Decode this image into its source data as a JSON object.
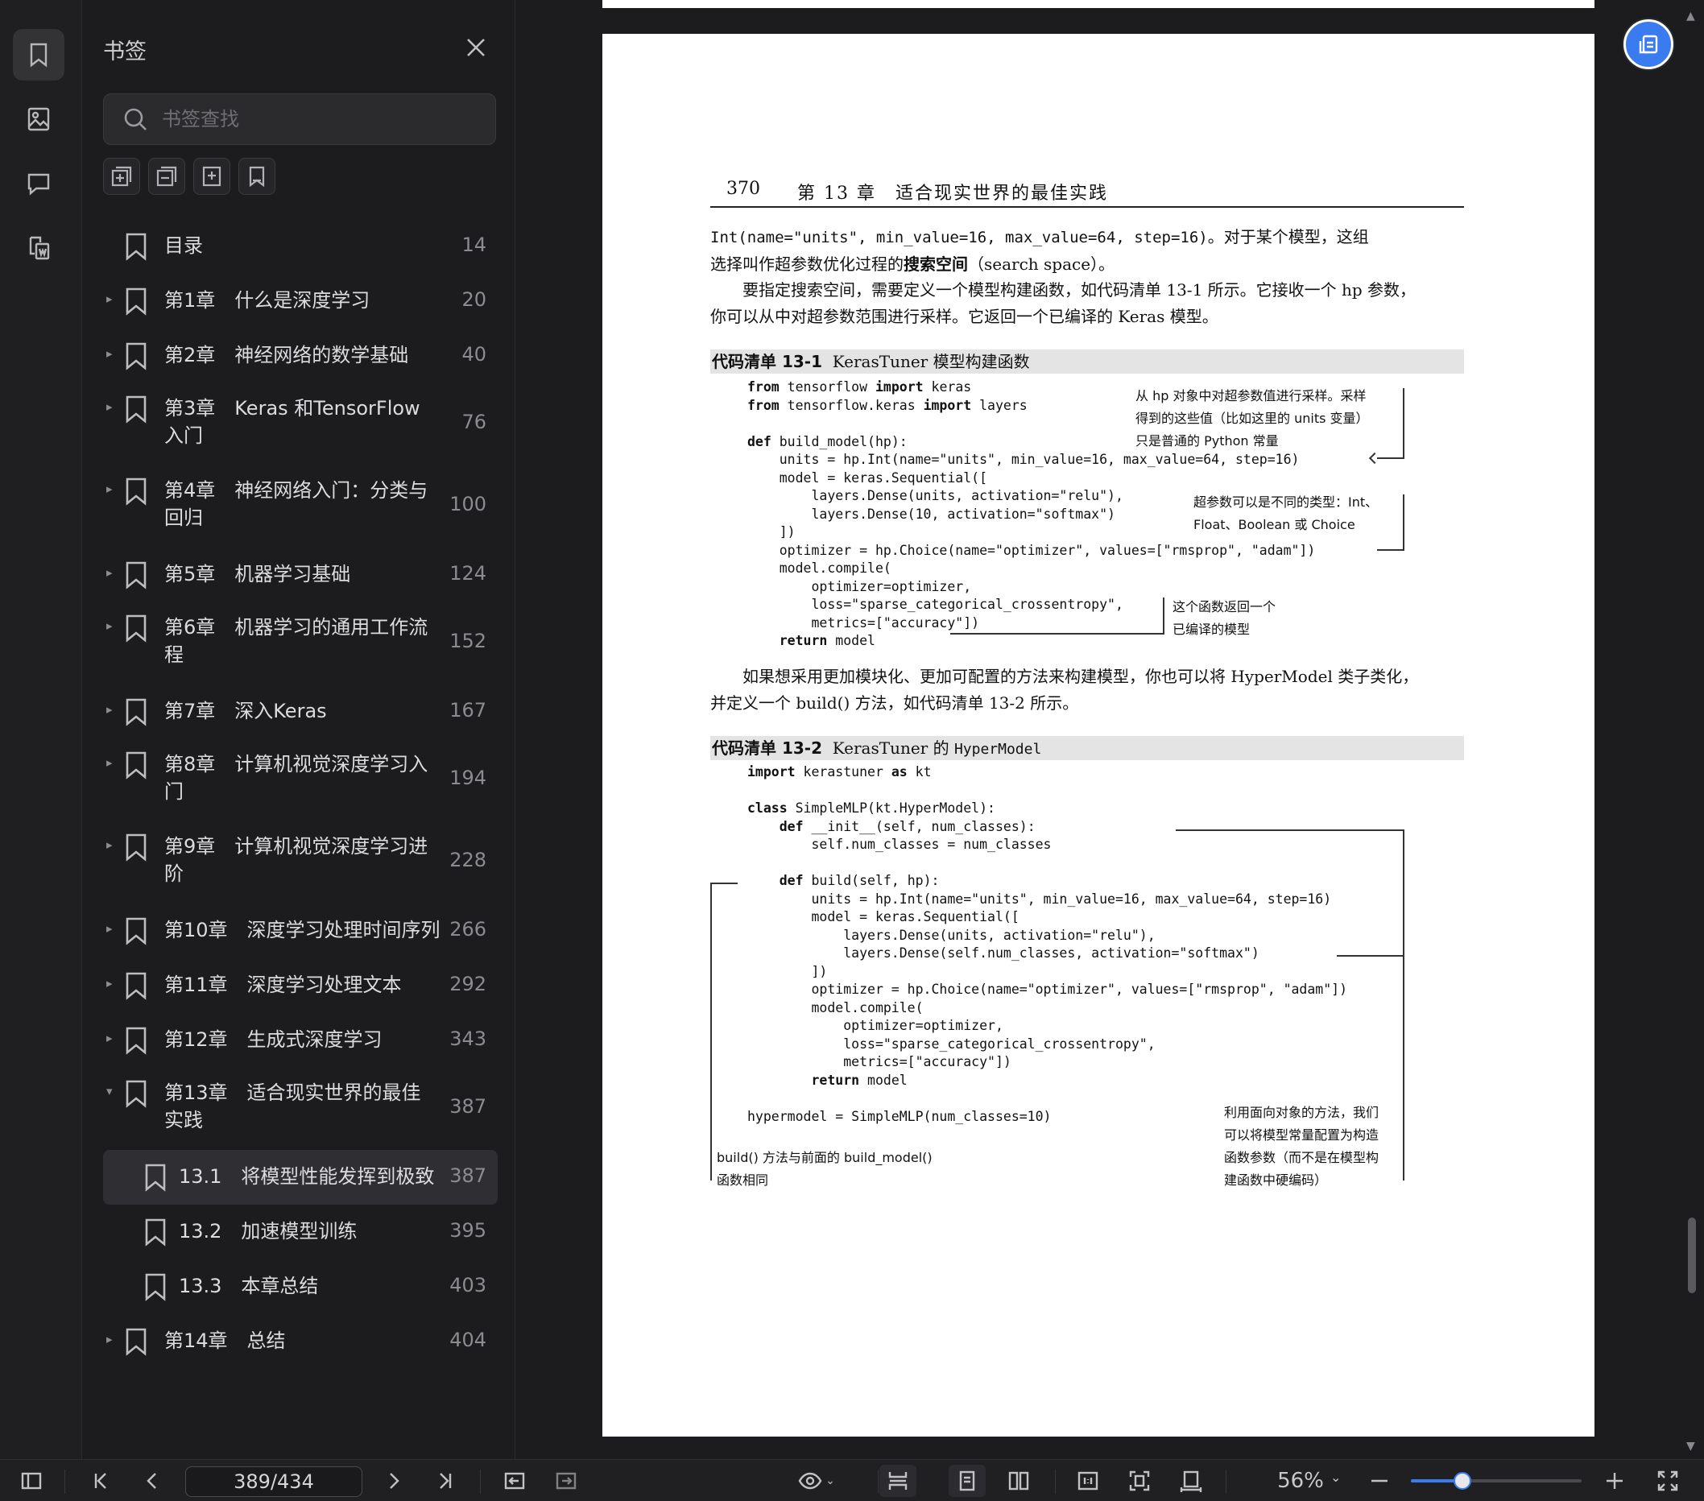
{
  "sidebar": {
    "title": "书签",
    "search_placeholder": "书签查找",
    "items": [
      {
        "label": "目录",
        "page": "14",
        "caret": "",
        "lines": 1,
        "indent": 0
      },
      {
        "label": "第1章　什么是深度学习",
        "page": "20",
        "caret": "▸",
        "lines": 1,
        "indent": 0
      },
      {
        "label": "第2章　神经网络的数学基础",
        "page": "40",
        "caret": "▸",
        "lines": 1,
        "indent": 0
      },
      {
        "label": "第3章　Keras 和TensorFlow 入门",
        "page": "76",
        "caret": "▸",
        "lines": 2,
        "indent": 0
      },
      {
        "label": "第4章　神经网络入门：分类与回归",
        "page": "100",
        "caret": "▸",
        "lines": 2,
        "indent": 0
      },
      {
        "label": "第5章　机器学习基础",
        "page": "124",
        "caret": "▸",
        "lines": 1,
        "indent": 0
      },
      {
        "label": "第6章　机器学习的通用工作流程",
        "page": "152",
        "caret": "▸",
        "lines": 2,
        "indent": 0
      },
      {
        "label": "第7章　深入Keras",
        "page": "167",
        "caret": "▸",
        "lines": 1,
        "indent": 0
      },
      {
        "label": "第8章　计算机视觉深度学习入门",
        "page": "194",
        "caret": "▸",
        "lines": 2,
        "indent": 0
      },
      {
        "label": "第9章　计算机视觉深度学习进阶",
        "page": "228",
        "caret": "▸",
        "lines": 2,
        "indent": 0
      },
      {
        "label": "第10章　深度学习处理时间序列",
        "page": "266",
        "caret": "▸",
        "lines": 1,
        "indent": 0
      },
      {
        "label": "第11章　深度学习处理文本",
        "page": "292",
        "caret": "▸",
        "lines": 1,
        "indent": 0
      },
      {
        "label": "第12章　生成式深度学习",
        "page": "343",
        "caret": "▸",
        "lines": 1,
        "indent": 0
      },
      {
        "label": "第13章　适合现实世界的最佳实践",
        "page": "387",
        "caret": "▾",
        "lines": 2,
        "indent": 0
      },
      {
        "label": "13.1　将模型性能发挥到极致",
        "page": "387",
        "caret": "",
        "lines": 1,
        "indent": 1,
        "selected": true
      },
      {
        "label": "13.2　加速模型训练",
        "page": "395",
        "caret": "",
        "lines": 1,
        "indent": 1
      },
      {
        "label": "13.3　本章总结",
        "page": "403",
        "caret": "",
        "lines": 1,
        "indent": 1
      },
      {
        "label": "第14章　总结",
        "page": "404",
        "caret": "▸",
        "lines": 1,
        "indent": 0
      }
    ]
  },
  "document": {
    "page_number": "370",
    "chapter_header": "第 13 章　适合现实世界的最佳实践",
    "p1_code": "Int(name=\"units\", min_value=16, max_value=64, step=16)",
    "p1_text_a": "。对于某个模型，这组",
    "p1_text_b": "选择叫作超参数优化过程的",
    "p1_bold": "搜索空间",
    "p1_text_c": "（search space）。",
    "p2_text_a": "　　要指定搜索空间，需要定义一个模型构建函数，如代码清单 13-1 所示。它接收一个 hp 参数，",
    "p2_text_b": "你可以从中对超参数范围进行采样。它返回一个已编译的 Keras 模型。",
    "listing1_label": "代码清单 13-1",
    "listing1_title": "KerasTuner 模型构建函数",
    "listing1_code": [
      "from tensorflow import keras",
      "from tensorflow.keras import layers",
      "",
      "def build_model(hp):",
      "    units = hp.Int(name=\"units\", min_value=16, max_value=64, step=16)",
      "    model = keras.Sequential([",
      "        layers.Dense(units, activation=\"relu\"),",
      "        layers.Dense(10, activation=\"softmax\")",
      "    ])",
      "    optimizer = hp.Choice(name=\"optimizer\", values=[\"rmsprop\", \"adam\"])",
      "    model.compile(",
      "        optimizer=optimizer,",
      "        loss=\"sparse_categorical_crossentropy\",",
      "        metrics=[\"accuracy\"])",
      "    return model"
    ],
    "anno1_line1": "从 hp 对象中对超参数值进行采样。采样",
    "anno1_line2": "得到的这些值（比如这里的 units 变量）",
    "anno1_line3": "只是普通的 Python 常量",
    "anno2_line1": "超参数可以是不同的类型：Int、",
    "anno2_line2": "Float、Boolean 或 Choice",
    "anno3_line1": "这个函数返回一个",
    "anno3_line2": "已编译的模型",
    "p3_text_a": "　　如果想采用更加模块化、更加可配置的方法来构建模型，你也可以将 HyperModel 类子类化，",
    "p3_text_b": "并定义一个 build() 方法，如代码清单 13-2 所示。",
    "listing2_label": "代码清单 13-2",
    "listing2_title": "KerasTuner 的 ",
    "listing2_title_code": "HyperModel",
    "listing2_code": [
      "import kerastuner as kt",
      "",
      "class SimpleMLP(kt.HyperModel):",
      "    def __init__(self, num_classes):",
      "        self.num_classes = num_classes",
      "",
      "    def build(self, hp):",
      "        units = hp.Int(name=\"units\", min_value=16, max_value=64, step=16)",
      "        model = keras.Sequential([",
      "            layers.Dense(units, activation=\"relu\"),",
      "            layers.Dense(self.num_classes, activation=\"softmax\")",
      "        ])",
      "        optimizer = hp.Choice(name=\"optimizer\", values=[\"rmsprop\", \"adam\"])",
      "        model.compile(",
      "            optimizer=optimizer,",
      "            loss=\"sparse_categorical_crossentropy\",",
      "            metrics=[\"accuracy\"])",
      "        return model",
      "",
      "hypermodel = SimpleMLP(num_classes=10)"
    ],
    "anno4_line1": "利用面向对象的方法，我们",
    "anno4_line2": "可以将模型常量配置为构造",
    "anno4_line3": "函数参数（而不是在模型构",
    "anno4_line4": "建函数中硬编码）",
    "anno5_line1": "build() 方法与前面的 build_model()",
    "anno5_line2": "函数相同"
  },
  "toolbar": {
    "page_indicator": "389/434",
    "zoom": "56%",
    "zoom_fraction": 0.3
  },
  "colors": {
    "accent": "#3a7bf0",
    "background": "#1c1c1e",
    "page": "#ffffff"
  }
}
